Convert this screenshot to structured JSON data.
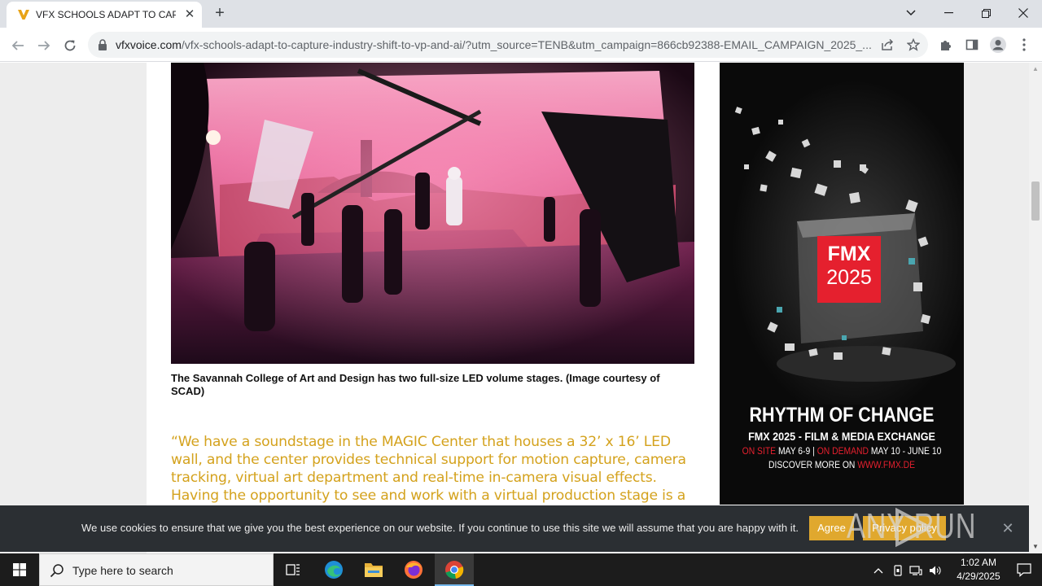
{
  "browser": {
    "tab_title": "VFX SCHOOLS ADAPT TO CAPTU",
    "url_host": "vfxvoice.com",
    "url_path": "/vfx-schools-adapt-to-capture-industry-shift-to-vp-and-ai/?utm_source=TENB&utm_campaign=866cb92388-EMAIL_CAMPAIGN_2025_..."
  },
  "article": {
    "image_caption": "The Savannah College of Art and Design has two full-size LED volume stages. (Image courtesy of SCAD)",
    "pull_quote": "“We have a soundstage in the MAGIC Center that houses a 32’ x 16’ LED wall, and the center provides technical support for motion capture, camera tracking, virtual art department and real-time in-camera visual effects. Having the opportunity to see and work with a virtual production stage is a great asset for our graduates.”"
  },
  "ad": {
    "badge_name": "FMX",
    "badge_year": "2025",
    "headline": "RHYTHM OF CHANGE",
    "subheadline": "FMX 2025 - FILM & MEDIA EXCHANGE",
    "on_site_label": "ON SITE",
    "on_site_dates": "MAY 6-9",
    "separator": "|",
    "on_demand_label": "ON DEMAND",
    "on_demand_dates": "MAY 10 - JUNE 10",
    "discover_text": "DISCOVER MORE ON",
    "discover_link": "WWW.FMX.DE"
  },
  "cookie_bar": {
    "message": "We use cookies to ensure that we give you the best experience on our website. If you continue to use this site we will assume that you are happy with it.",
    "agree_label": "Agree",
    "privacy_label": "Privacy policy",
    "watermark": "ANY RUN"
  },
  "taskbar": {
    "search_placeholder": "Type here to search",
    "time": "1:02 AM",
    "date": "4/29/2025"
  },
  "colors": {
    "quote_gold": "#d4a21d",
    "agree_button": "#e0a82e",
    "fmx_red": "#e5202e",
    "cookie_bar_bg": "#2b2f33"
  },
  "icons": [
    "favicon-v",
    "close-icon",
    "plus-icon",
    "chevron-down-icon",
    "minimize-icon",
    "restore-icon",
    "back-arrow-icon",
    "forward-arrow-icon",
    "reload-icon",
    "lock-icon",
    "share-icon",
    "star-icon",
    "extensions-icon",
    "sidebar-icon",
    "profile-icon",
    "kebab-menu-icon",
    "windows-start-icon",
    "search-icon",
    "task-view-icon",
    "edge-icon",
    "file-explorer-icon",
    "firefox-icon",
    "chrome-icon",
    "notification-icon"
  ]
}
